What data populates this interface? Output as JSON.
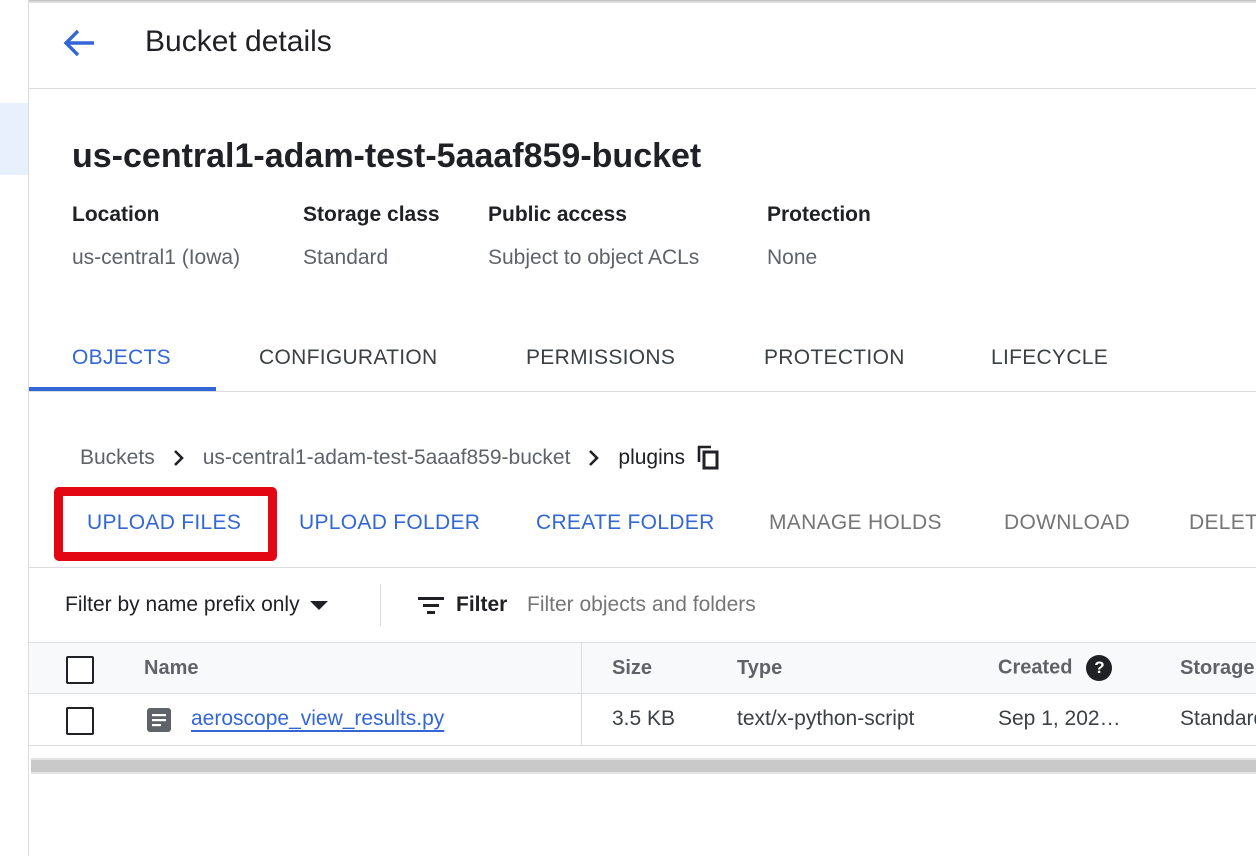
{
  "header": {
    "title": "Bucket details",
    "back_icon": "arrow-back-icon"
  },
  "bucket": {
    "name": "us-central1-adam-test-5aaaf859-bucket",
    "meta": [
      {
        "label": "Location",
        "value": "us-central1 (Iowa)"
      },
      {
        "label": "Storage class",
        "value": "Standard"
      },
      {
        "label": "Public access",
        "value": "Subject to object ACLs"
      },
      {
        "label": "Protection",
        "value": "None"
      }
    ]
  },
  "tabs": [
    {
      "label": "OBJECTS",
      "active": true
    },
    {
      "label": "CONFIGURATION",
      "active": false
    },
    {
      "label": "PERMISSIONS",
      "active": false
    },
    {
      "label": "PROTECTION",
      "active": false
    },
    {
      "label": "LIFECYCLE",
      "active": false
    }
  ],
  "breadcrumb": {
    "items": [
      "Buckets",
      "us-central1-adam-test-5aaaf859-bucket",
      "plugins"
    ],
    "copy_icon": "copy-icon"
  },
  "actions": {
    "upload_files": "UPLOAD FILES",
    "upload_folder": "UPLOAD FOLDER",
    "create_folder": "CREATE FOLDER",
    "manage_holds": "MANAGE HOLDS",
    "download": "DOWNLOAD",
    "delete": "DELETE"
  },
  "filter": {
    "mode": "Filter by name prefix only",
    "label": "Filter",
    "placeholder": "Filter objects and folders"
  },
  "table": {
    "columns": {
      "name": "Name",
      "size": "Size",
      "type": "Type",
      "created": "Created",
      "storage": "Storage class"
    },
    "rows": [
      {
        "name": "aeroscope_view_results.py",
        "size": "3.5 KB",
        "type": "text/x-python-script",
        "created": "Sep 1, 202…",
        "storage": "Standard"
      }
    ]
  },
  "colors": {
    "accent": "#3367d6",
    "highlight": "#e30613",
    "tab_active_bg": "#e8f0fe"
  }
}
